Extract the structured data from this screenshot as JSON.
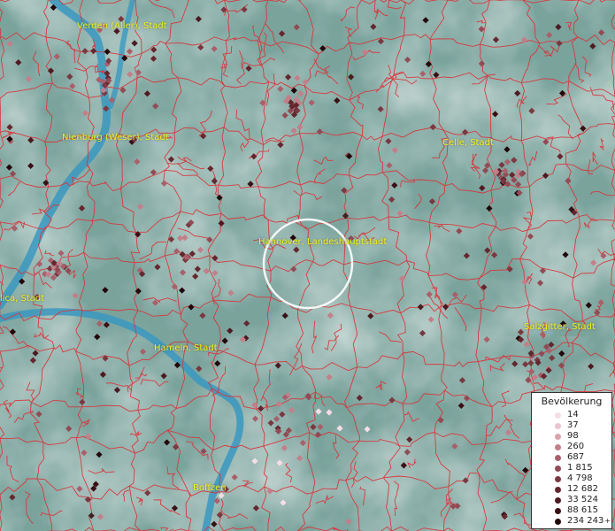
{
  "map": {
    "cities": [
      {
        "id": "verden",
        "label": "Verden (Aller), Stadt"
      },
      {
        "id": "nienburg",
        "label": "Nienburg (Weser), Stadt"
      },
      {
        "id": "celle",
        "label": "Celle, Stadt"
      },
      {
        "id": "hannover",
        "label": "Hannover, Landeshauptstadt"
      },
      {
        "id": "minden",
        "label": "lica, Stadt"
      },
      {
        "id": "hameln",
        "label": "Hameln, Stadt"
      },
      {
        "id": "salzgitter",
        "label": "Salzgitter, Stadt"
      },
      {
        "id": "boffzen",
        "label": "Boffzen"
      }
    ],
    "colors": {
      "background": "#7fa59e",
      "borders": "#d9343a",
      "river": "#3a98c0",
      "label": "#f2ef1a"
    }
  },
  "legend": {
    "title": "Bevölkerung",
    "items": [
      {
        "label": "14",
        "color": "#f6dde6"
      },
      {
        "label": "37",
        "color": "#ecc3d0"
      },
      {
        "label": "98",
        "color": "#d9a2ad"
      },
      {
        "label": "260",
        "color": "#c27f8a"
      },
      {
        "label": "687",
        "color": "#a9606b"
      },
      {
        "label": "1 815",
        "color": "#914b54"
      },
      {
        "label": "4 798",
        "color": "#7a3840"
      },
      {
        "label": "12 682",
        "color": "#64272e"
      },
      {
        "label": "33 524",
        "color": "#4e1a20"
      },
      {
        "label": "88 615",
        "color": "#3a1015"
      },
      {
        "label": "234 243",
        "color": "#22070a",
        "plus": "+"
      }
    ]
  }
}
